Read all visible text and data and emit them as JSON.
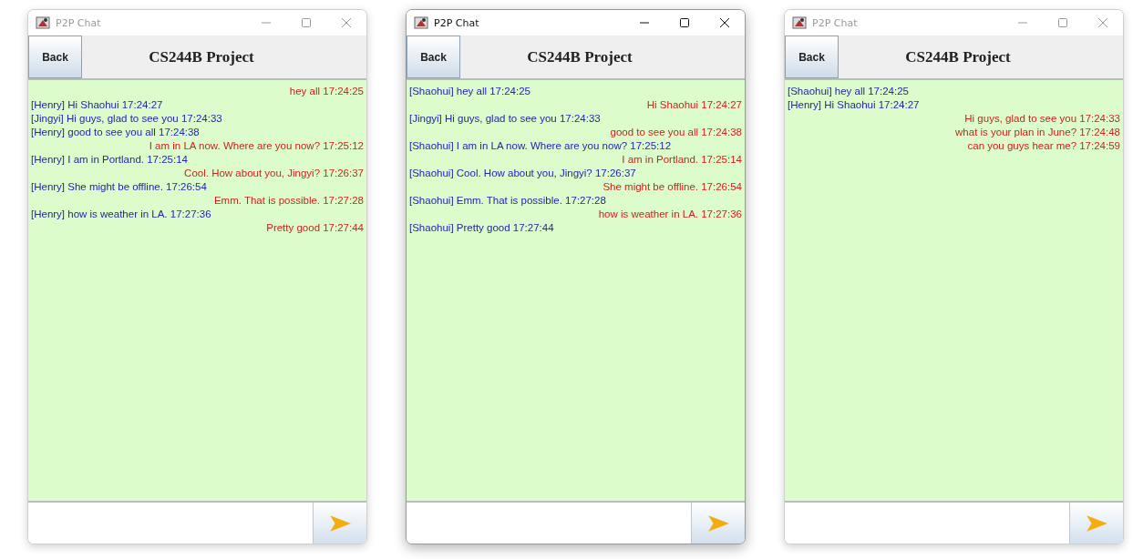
{
  "windows": [
    {
      "title": "P2P Chat",
      "focused": false,
      "back_label": "Back",
      "heading": "CS244B Project",
      "messages": [
        {
          "kind": "sent",
          "text": "hey all 17:24:25"
        },
        {
          "kind": "received",
          "text": "[Henry] Hi Shaohui 17:24:27"
        },
        {
          "kind": "received",
          "text": "[Jingyi] Hi guys, glad to see you 17:24:33"
        },
        {
          "kind": "received",
          "text": "[Henry] good to see you all 17:24:38"
        },
        {
          "kind": "sent",
          "text": "I am in LA now. Where are you now? 17:25:12"
        },
        {
          "kind": "received",
          "text": "[Henry] I am in Portland. 17:25:14"
        },
        {
          "kind": "sent",
          "text": "Cool. How about you, Jingyi? 17:26:37"
        },
        {
          "kind": "received",
          "text": "[Henry] She might be offline. 17:26:54"
        },
        {
          "kind": "sent",
          "text": "Emm. That is possible. 17:27:28"
        },
        {
          "kind": "received",
          "text": "[Henry] how is weather in LA. 17:27:36"
        },
        {
          "kind": "sent",
          "text": "Pretty good 17:27:44"
        }
      ]
    },
    {
      "title": "P2P Chat",
      "focused": true,
      "back_label": "Back",
      "heading": "CS244B Project",
      "messages": [
        {
          "kind": "received",
          "text": "[Shaohui] hey all 17:24:25"
        },
        {
          "kind": "sent",
          "text": "Hi Shaohui 17:24:27"
        },
        {
          "kind": "received",
          "text": "[Jingyi] Hi guys, glad to see you 17:24:33"
        },
        {
          "kind": "sent",
          "text": "good to see you all 17:24:38"
        },
        {
          "kind": "received",
          "text": "[Shaohui] I am in LA now. Where are you now? 17:25:12"
        },
        {
          "kind": "sent",
          "text": "I am in Portland. 17:25:14"
        },
        {
          "kind": "received",
          "text": "[Shaohui] Cool. How about you, Jingyi? 17:26:37"
        },
        {
          "kind": "sent",
          "text": "She might be offline. 17:26:54"
        },
        {
          "kind": "received",
          "text": "[Shaohui] Emm. That is possible. 17:27:28"
        },
        {
          "kind": "sent",
          "text": "how is weather in LA. 17:27:36"
        },
        {
          "kind": "received",
          "text": "[Shaohui] Pretty good 17:27:44"
        }
      ]
    },
    {
      "title": "P2P Chat",
      "focused": false,
      "back_label": "Back",
      "heading": "CS244B Project",
      "messages": [
        {
          "kind": "received",
          "text": "[Shaohui] hey all 17:24:25"
        },
        {
          "kind": "received",
          "text": "[Henry] Hi Shaohui 17:24:27"
        },
        {
          "kind": "sent",
          "text": "Hi guys, glad to see you 17:24:33"
        },
        {
          "kind": "sent",
          "text": "what is your plan in June? 17:24:48"
        },
        {
          "kind": "sent",
          "text": "can you guys hear me? 17:24:59"
        }
      ]
    }
  ]
}
